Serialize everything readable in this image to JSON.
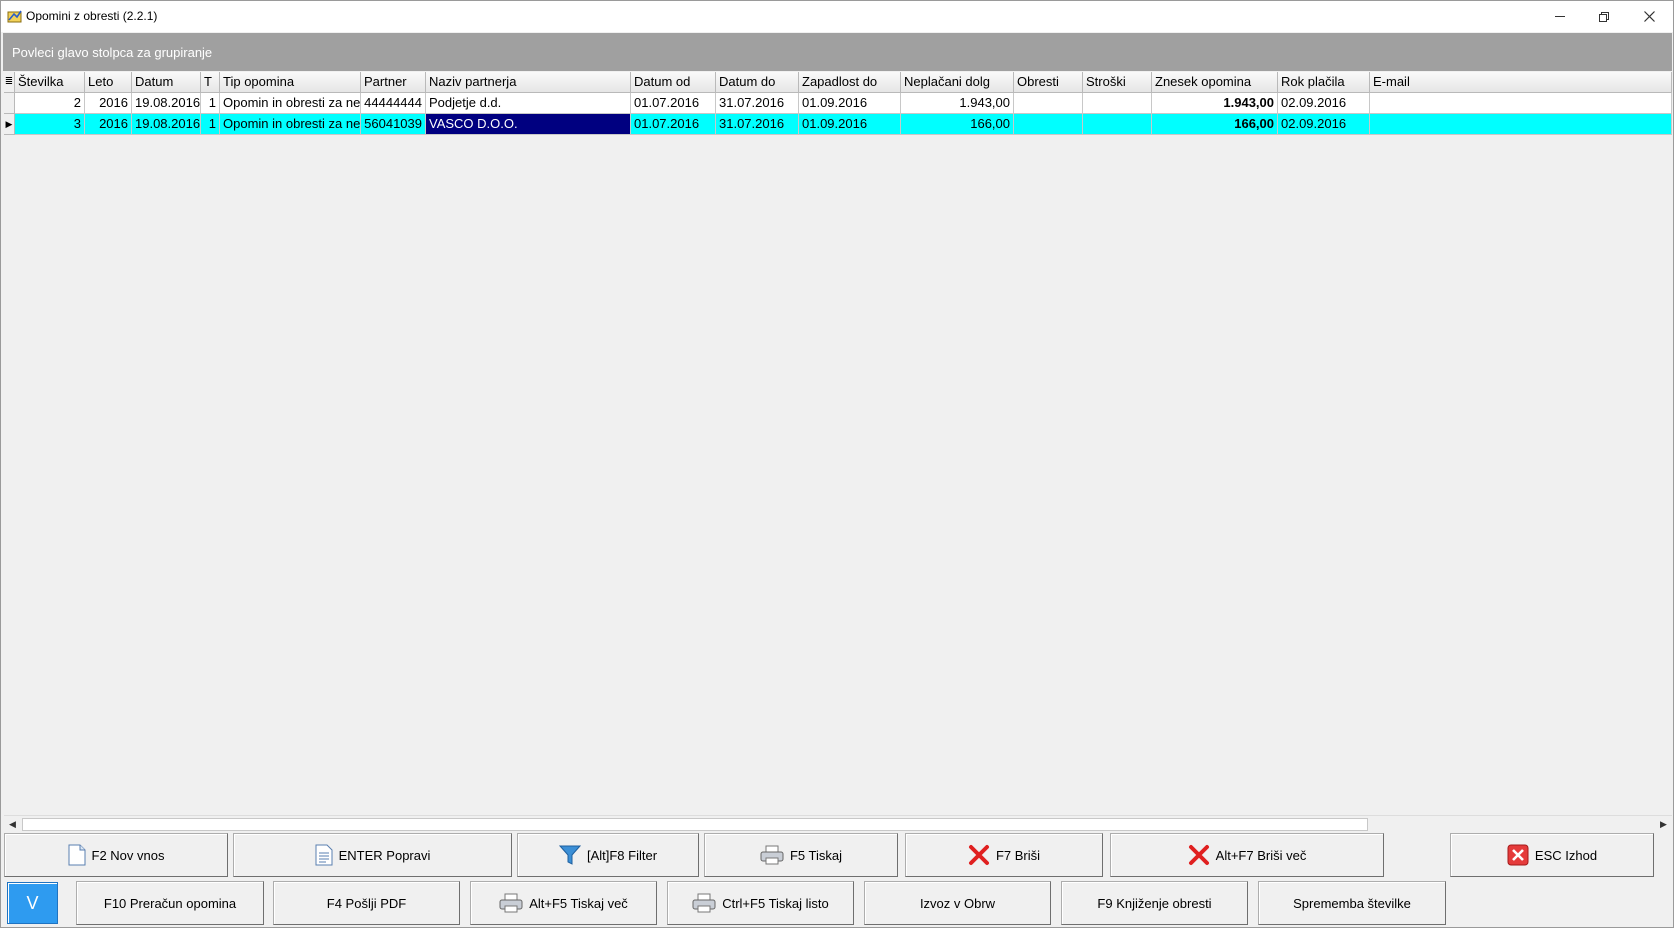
{
  "window": {
    "title": "Opomini z obresti  (2.2.1)"
  },
  "group_panel": {
    "hint": "Povleci glavo stolpca za grupiranje"
  },
  "grid": {
    "columns": [
      "Številka",
      "Leto",
      "Datum",
      "T",
      "Tip opomina",
      "Partner",
      "Naziv partnerja",
      "Datum od",
      "Datum do",
      "Zapadlost do",
      "Neplačani dolg",
      "Obresti",
      "Stroški",
      "Znesek opomina",
      "Rok plačila",
      "E-mail"
    ],
    "rows": [
      [
        "2",
        "2016",
        "19.08.2016",
        "1",
        "Opomin in obresti za nep",
        "44444444",
        "Podjetje d.d.",
        "01.07.2016",
        "31.07.2016",
        "01.09.2016",
        "1.943,00",
        "",
        "",
        "1.943,00",
        "02.09.2016",
        ""
      ],
      [
        "3",
        "2016",
        "19.08.2016",
        "1",
        "Opomin in obresti za nep",
        "56041039",
        "VASCO D.O.O.",
        "01.07.2016",
        "31.07.2016",
        "01.09.2016",
        "166,00",
        "",
        "",
        "166,00",
        "02.09.2016",
        ""
      ]
    ],
    "selected_row": 1
  },
  "buttons": {
    "row1": {
      "new": "F2 Nov vnos",
      "edit": "ENTER Popravi",
      "filter": "[Alt]F8 Filter",
      "print": "F5 Tiskaj",
      "delete": "F7 Briši",
      "delete_more": "Alt+F7 Briši več",
      "exit": "ESC Izhod"
    },
    "row2": {
      "v": "V",
      "recalc": "F10 Preračun opomina",
      "send_pdf": "F4 Pošlji PDF",
      "print_more": "Alt+F5 Tiskaj več",
      "print_sheet": "Ctrl+F5 Tiskaj listo",
      "export": "Izvoz v Obrw",
      "post_interest": "F9 Knjiženje obresti",
      "change_number": "Sprememba številke"
    }
  },
  "colors": {
    "selected_row": "#00ffff",
    "focused_cell": "#000080",
    "group_panel": "#a0a0a0"
  }
}
